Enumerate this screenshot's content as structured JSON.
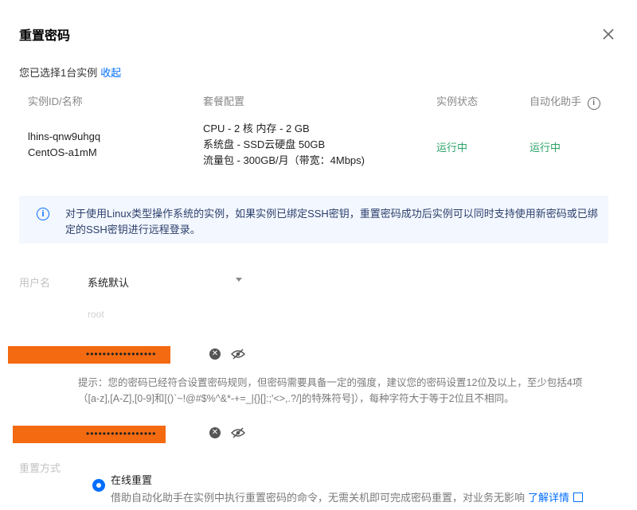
{
  "dialog": {
    "title": "重置密码"
  },
  "selection": {
    "text": "您已选择1台实例",
    "collapse_link": "收起"
  },
  "table": {
    "headers": [
      "实例ID/名称",
      "套餐配置",
      "实例状态",
      "自动化助手"
    ],
    "row": {
      "id": "lhins-qnw9uhgq",
      "name": "CentOS-a1mM",
      "config": [
        "CPU - 2 核 内存 - 2 GB",
        "系统盘 - SSD云硬盘 50GB",
        "流量包 - 300GB/月（带宽：4Mbps)"
      ],
      "instance_status": "运行中",
      "agent_status": "运行中"
    }
  },
  "notice": {
    "icon": "info-icon",
    "text": "对于使用Linux类型操作系统的实例，如果实例已绑定SSH密钥，重置密码成功后实例可以同时支持使用新密码或已绑定的SSH密钥进行远程登录。"
  },
  "form": {
    "username_label": "用户名",
    "username_value": "系统默认",
    "username_hint": "root",
    "new_password_value": "•••••••••••••••••",
    "password_hint": "提示：您的密码已经符合设置密码规则，但密码需要具备一定的强度，建议您的密码设置12位及以上，至少包括4项（[a-z],[A-Z],[0-9]和[()`~!@#$%^&*-+=_|{}[]:;'<>,.?/]的特殊符号]），每种字符大于等于2位且不相同。",
    "confirm_password_value": "•••••••••••••••••",
    "reset_method_label": "重置方式",
    "reset_option_label": "在线重置",
    "reset_option_desc": "借助自动化助手在实例中执行重置密码的命令，无需关机即可完成密码重置，对业务无影响",
    "learn_more": "了解详情"
  },
  "colors": {
    "accent": "#006eff",
    "running": "#29a366",
    "redaction": "#f36a10"
  }
}
